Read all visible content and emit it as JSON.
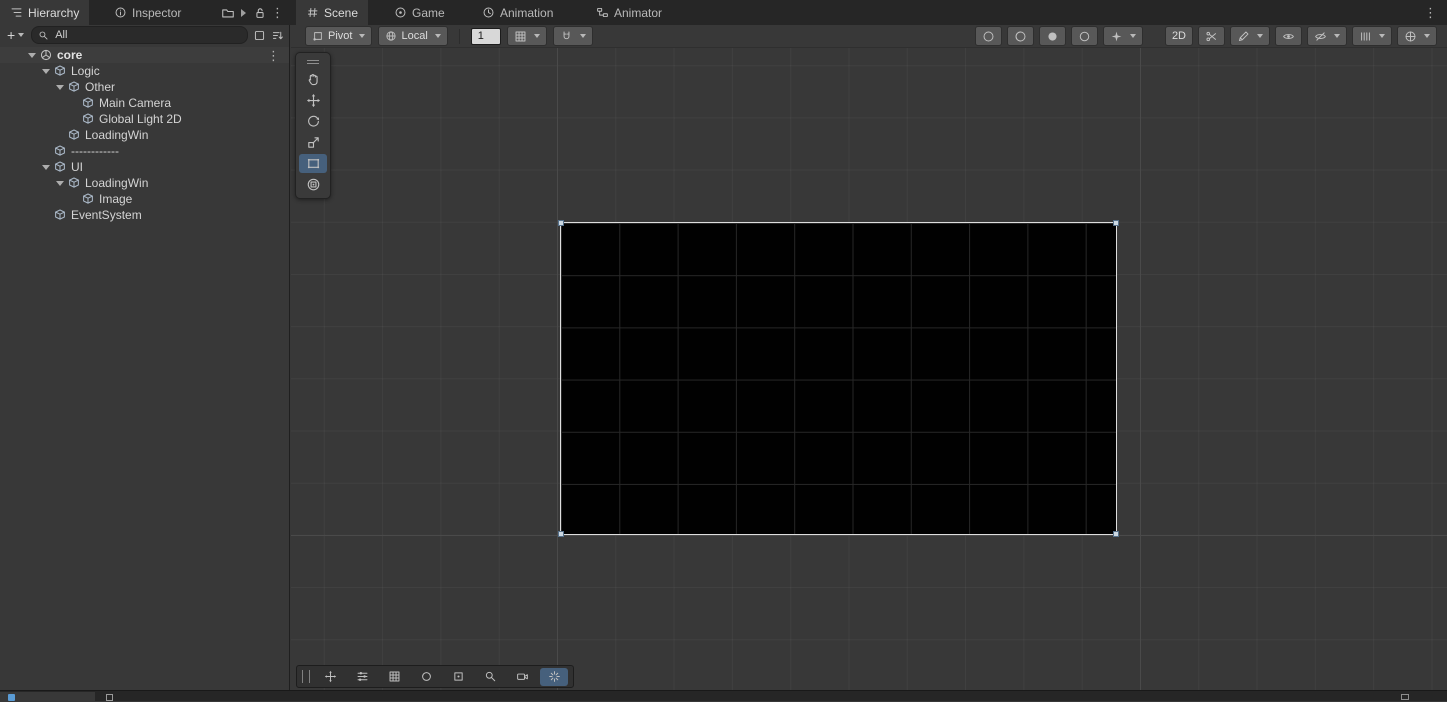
{
  "glyphs": {
    "kebab": "⋮"
  },
  "panel_tabs": {
    "hierarchy": "Hierarchy",
    "inspector": "Inspector"
  },
  "view_tabs": {
    "scene": "Scene",
    "game": "Game",
    "animation": "Animation",
    "animator": "Animator"
  },
  "hierarchy_toolbar": {
    "create_label": "+",
    "search_value": "All"
  },
  "hierarchy_items": {
    "core": "core",
    "logic": "Logic",
    "other": "Other",
    "main_camera": "Main Camera",
    "global_light": "Global Light 2D",
    "loadingwin_logic": "LoadingWin",
    "separator": "------------",
    "ui": "UI",
    "loadingwin_ui": "LoadingWin",
    "image": "Image",
    "eventsystem": "EventSystem"
  },
  "scene_toolbar": {
    "pivot": "Pivot",
    "orientation": "Local",
    "snap_value": "1",
    "mode_2d": "2D"
  },
  "colors": {
    "selection": "#46607c",
    "panel_bg": "#383838",
    "tabbar_bg": "#262626",
    "canvas_bg": "#000000",
    "canvas_outline": "#dedede",
    "grid_major": "#4a4a4a"
  }
}
